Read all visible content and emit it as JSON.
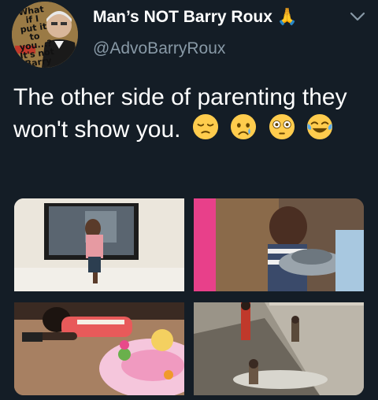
{
  "header": {
    "display_name": "Man’s NOT Barry Roux 🙏",
    "username": "@AdvoBarryRoux",
    "avatar_lines": [
      "What",
      "if I",
      "put it",
      "to you...?",
      "It's not",
      "Barry"
    ]
  },
  "tweet": {
    "text": "The other side of parenting they won't show you.",
    "emojis": [
      "pensive-face",
      "crying-face",
      "flushed-face",
      "tears-of-joy-face"
    ]
  },
  "colors": {
    "background": "#141d26",
    "primary_text": "#ffffff",
    "secondary_text": "#8899a6"
  },
  "media": {
    "images": [
      "child-climbing-tv-photo",
      "child-drinking-from-pot-photo",
      "child-lying-on-floor-toy-photo",
      "children-in-flooded-yard-photo"
    ]
  }
}
